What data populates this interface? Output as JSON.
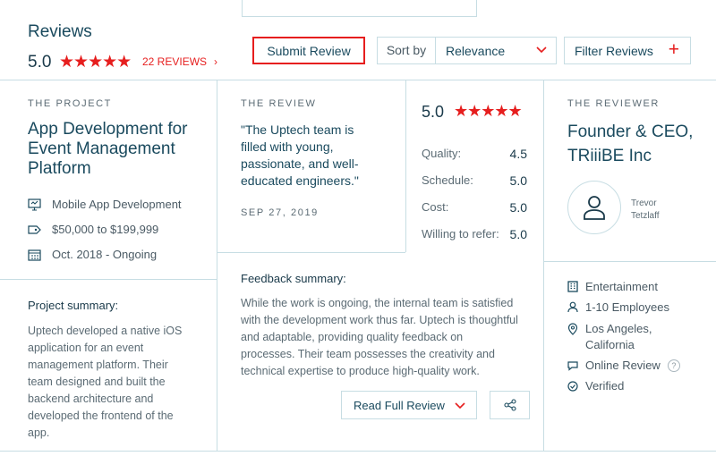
{
  "header": {
    "title": "Reviews",
    "rating": "5.0",
    "stars": "★★★★★",
    "review_count": "22 REVIEWS",
    "chevron": "›",
    "submit_label": "Submit Review",
    "sort_label": "Sort by",
    "sort_value": "Relevance",
    "filter_label": "Filter Reviews",
    "plus": "+"
  },
  "project": {
    "caption": "THE PROJECT",
    "title": "App Development for Event Management Platform",
    "details": [
      {
        "icon": "monitor-icon",
        "text": "Mobile App Development"
      },
      {
        "icon": "price-tag-icon",
        "text": "$50,000 to $199,999"
      },
      {
        "icon": "calendar-icon",
        "text": "Oct. 2018 - Ongoing"
      }
    ],
    "summary_heading": "Project summary:",
    "summary_text": "Uptech developed a native iOS application for an event management platform. Their team designed and built the backend architecture and developed the frontend of the app."
  },
  "review": {
    "caption": "THE REVIEW",
    "quote": "\"The Uptech team is filled with young, passionate, and well-educated engineers.\"",
    "date": "SEP 27, 2019",
    "overall": "5.0",
    "stars": "★★★★★",
    "scores": [
      {
        "label": "Quality:",
        "value": "4.5"
      },
      {
        "label": "Schedule:",
        "value": "5.0"
      },
      {
        "label": "Cost:",
        "value": "5.0"
      },
      {
        "label": "Willing to refer:",
        "value": "5.0"
      }
    ],
    "feedback_heading": "Feedback summary:",
    "feedback_text": "While the work is ongoing, the internal team is satisfied with the development work thus far. Uptech is thoughtful and adaptable, providing quality feedback on processes. Their team possesses the creativity and technical expertise to produce high-quality work.",
    "read_full_label": "Read Full Review"
  },
  "reviewer": {
    "caption": "THE REVIEWER",
    "title": "Founder & CEO, TRiiiBE Inc",
    "name": "Trevor Tetzlaff",
    "details": [
      {
        "icon": "building-icon",
        "text": "Entertainment"
      },
      {
        "icon": "person-icon",
        "text": "1-10 Employees"
      },
      {
        "icon": "location-pin-icon",
        "text": "Los Angeles, California"
      },
      {
        "icon": "speech-bubble-icon",
        "text": "Online Review"
      },
      {
        "icon": "check-circle-icon",
        "text": "Verified"
      }
    ],
    "help": "?"
  },
  "colors": {
    "accent": "#e61e1e",
    "heading": "#1a4a5e",
    "border": "#c7dde3"
  }
}
